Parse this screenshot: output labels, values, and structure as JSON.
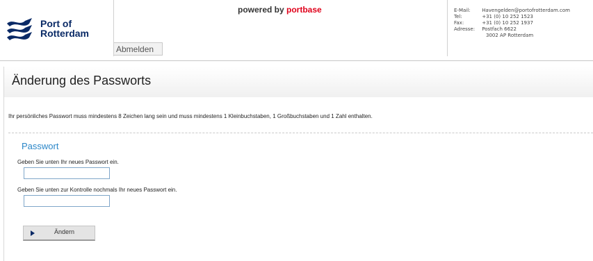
{
  "header": {
    "logo": {
      "line1": "Port of",
      "line2": "Rotterdam"
    },
    "powered_prefix": "powered by ",
    "powered_brand": "portbase",
    "logout_label": "Abmelden",
    "contact": {
      "email_label": "E-Mail:",
      "email": "Havengelden@portofrotterdam.com",
      "tel_label": "Tel:",
      "tel": "+31 (0) 10 252 1523",
      "fax_label": "Fax:",
      "fax": "+31 (0) 10 252 1937",
      "address_label": "Adresse:",
      "address_line1": "Postfach 6622",
      "address_line2": "3002 AP  Rotterdam"
    }
  },
  "main": {
    "title": "Änderung des Passworts",
    "info": "Ihr persönliches Passwort muss mindestens 8 Zeichen lang sein und muss mindestens 1 Kleinbuchstaben, 1 Großbuchstaben und 1 Zahl enthalten.",
    "section_title": "Passwort",
    "new_password_label": "Geben Sie unten Ihr neues Passwort ein.",
    "confirm_password_label": "Geben Sie unten zur Kontrolle nochmals Ihr neues Passwort ein.",
    "new_password_value": "",
    "confirm_password_value": "",
    "submit_label": "Ändern"
  },
  "colors": {
    "brand_navy": "#0a2a66",
    "portbase_red": "#e0001a",
    "section_blue": "#2a86c8"
  },
  "icons": {
    "logo": "port-of-rotterdam-wave-logo",
    "submit": "play-arrow-icon"
  }
}
